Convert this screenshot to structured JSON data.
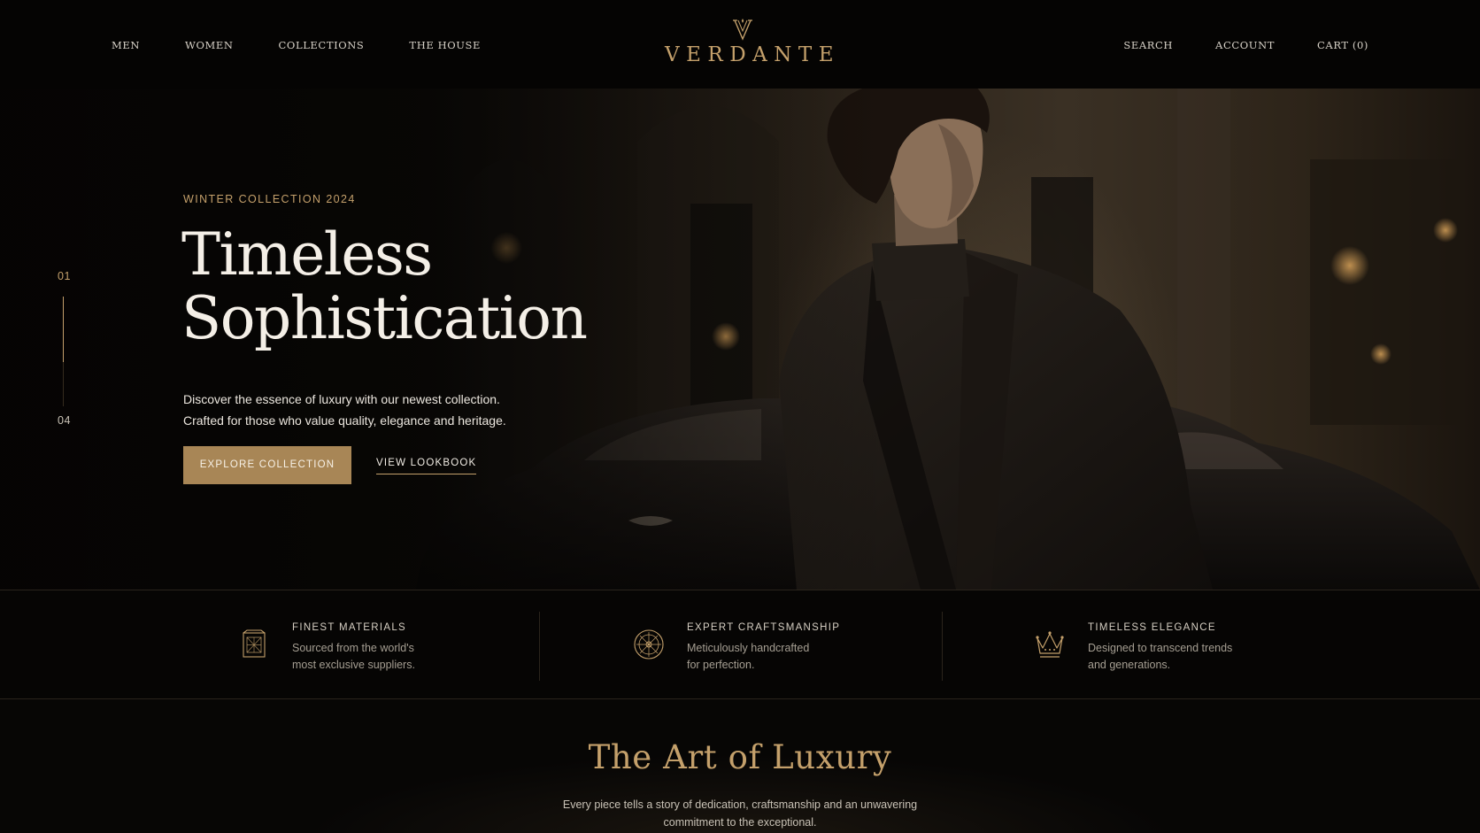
{
  "brand": {
    "name": "VERDANTE",
    "logo_icon": "crest-v-icon",
    "accent_color": "#c4a06b",
    "button_color": "#a88656",
    "background_color": "#060504"
  },
  "nav": {
    "left": [
      {
        "label": "MEN"
      },
      {
        "label": "WOMEN"
      },
      {
        "label": "COLLECTIONS"
      },
      {
        "label": "THE HOUSE"
      }
    ],
    "right": {
      "search": "SEARCH",
      "account": "ACCOUNT",
      "cart": "CART (0)"
    }
  },
  "hero": {
    "eyebrow": "WINTER COLLECTION 2024",
    "title_line1": "Timeless",
    "title_line2": "Sophistication",
    "description_line1": "Discover the essence of luxury with our newest collection.",
    "description_line2": "Crafted for those who value quality, elegance and heritage.",
    "primary_cta": "EXPLORE COLLECTION",
    "secondary_cta": "VIEW LOOKBOOK",
    "slider": {
      "current_label": "01",
      "total_label": "04",
      "progress_fraction": 0.6
    }
  },
  "features": [
    {
      "icon": "fabric-swatch-icon",
      "title": "FINEST MATERIALS",
      "text_line1": "Sourced from the world's",
      "text_line2": "most exclusive suppliers."
    },
    {
      "icon": "compass-medallion-icon",
      "title": "EXPERT CRAFTSMANSHIP",
      "text_line1": "Meticulously handcrafted",
      "text_line2": "for perfection."
    },
    {
      "icon": "crown-icon",
      "title": "TIMELESS ELEGANCE",
      "text_line1": "Designed to transcend trends",
      "text_line2": "and generations."
    }
  ],
  "art_section": {
    "title": "The Art of Luxury",
    "text_line1": "Every piece tells a story of dedication, craftsmanship and an unwavering",
    "text_line2": "commitment to the exceptional."
  }
}
